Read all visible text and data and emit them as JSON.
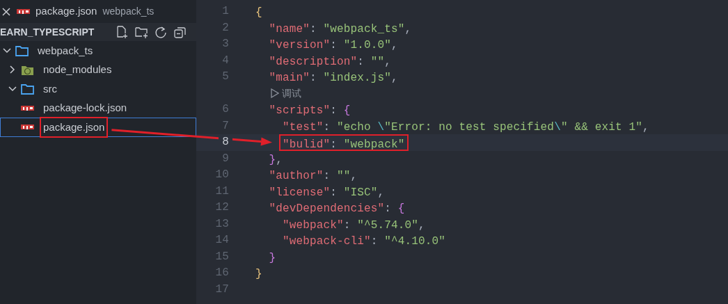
{
  "tab": {
    "file": "package.json",
    "folder": "webpack_ts"
  },
  "explorer": {
    "title": "EARN_TYPESCRIPT",
    "tree": [
      {
        "label": "webpack_ts",
        "kind": "folder",
        "expanded": true,
        "selected": false,
        "annotated": false,
        "children": [
          {
            "label": "node_modules",
            "kind": "node-folder",
            "expanded": false,
            "selected": false,
            "annotated": false
          },
          {
            "label": "src",
            "kind": "folder",
            "expanded": true,
            "selected": false,
            "annotated": false
          },
          {
            "label": "package-lock.json",
            "kind": "npm",
            "selected": false,
            "annotated": false
          },
          {
            "label": "package.json",
            "kind": "npm",
            "selected": true,
            "annotated": true
          }
        ]
      }
    ]
  },
  "editor": {
    "lines": [
      {
        "kind": "code",
        "number": "1",
        "current": false,
        "annotated": false,
        "tokens": [
          {
            "kind": "brace1",
            "text": "{"
          }
        ]
      },
      {
        "kind": "code",
        "number": "2",
        "current": false,
        "annotated": false,
        "tokens": [
          {
            "kind": "key",
            "text": "  \"name\""
          },
          {
            "kind": "punct",
            "text": ": "
          },
          {
            "kind": "string",
            "text": "\"webpack_ts\""
          },
          {
            "kind": "punct",
            "text": ","
          }
        ]
      },
      {
        "kind": "code",
        "number": "3",
        "current": false,
        "annotated": false,
        "tokens": [
          {
            "kind": "key",
            "text": "  \"version\""
          },
          {
            "kind": "punct",
            "text": ": "
          },
          {
            "kind": "string",
            "text": "\"1.0.0\""
          },
          {
            "kind": "punct",
            "text": ","
          }
        ]
      },
      {
        "kind": "code",
        "number": "4",
        "current": false,
        "annotated": false,
        "tokens": [
          {
            "kind": "key",
            "text": "  \"description\""
          },
          {
            "kind": "punct",
            "text": ": "
          },
          {
            "kind": "string",
            "text": "\"\""
          },
          {
            "kind": "punct",
            "text": ","
          }
        ]
      },
      {
        "kind": "code",
        "number": "5",
        "current": false,
        "annotated": false,
        "tokens": [
          {
            "kind": "key",
            "text": "  \"main\""
          },
          {
            "kind": "punct",
            "text": ": "
          },
          {
            "kind": "string",
            "text": "\"index.js\""
          },
          {
            "kind": "punct",
            "text": ","
          }
        ]
      },
      {
        "kind": "codelens",
        "text": "调试"
      },
      {
        "kind": "code",
        "number": "6",
        "current": false,
        "annotated": false,
        "tokens": [
          {
            "kind": "key",
            "text": "  \"scripts\""
          },
          {
            "kind": "punct",
            "text": ": "
          },
          {
            "kind": "brace2",
            "text": "{"
          }
        ]
      },
      {
        "kind": "code",
        "number": "7",
        "current": false,
        "annotated": false,
        "tokens": [
          {
            "kind": "key",
            "text": "    \"test\""
          },
          {
            "kind": "punct",
            "text": ": "
          },
          {
            "kind": "string",
            "text": "\"echo "
          },
          {
            "kind": "escape",
            "text": "\\"
          },
          {
            "kind": "string",
            "text": "\"Error: no test specified"
          },
          {
            "kind": "escape",
            "text": "\\"
          },
          {
            "kind": "string",
            "text": "\" && exit 1\""
          },
          {
            "kind": "punct",
            "text": ","
          }
        ]
      },
      {
        "kind": "code",
        "number": "8",
        "current": true,
        "annotated": true,
        "tokens": [
          {
            "kind": "key",
            "text": "    \"bulid\""
          },
          {
            "kind": "punct",
            "text": ": "
          },
          {
            "kind": "string",
            "text": "\"webpack\""
          }
        ]
      },
      {
        "kind": "code",
        "number": "9",
        "current": false,
        "annotated": false,
        "tokens": [
          {
            "kind": "brace2",
            "text": "  }"
          },
          {
            "kind": "punct",
            "text": ","
          }
        ]
      },
      {
        "kind": "code",
        "number": "10",
        "current": false,
        "annotated": false,
        "tokens": [
          {
            "kind": "key",
            "text": "  \"author\""
          },
          {
            "kind": "punct",
            "text": ": "
          },
          {
            "kind": "string",
            "text": "\"\""
          },
          {
            "kind": "punct",
            "text": ","
          }
        ]
      },
      {
        "kind": "code",
        "number": "11",
        "current": false,
        "annotated": false,
        "tokens": [
          {
            "kind": "key",
            "text": "  \"license\""
          },
          {
            "kind": "punct",
            "text": ": "
          },
          {
            "kind": "string",
            "text": "\"ISC\""
          },
          {
            "kind": "punct",
            "text": ","
          }
        ]
      },
      {
        "kind": "code",
        "number": "12",
        "current": false,
        "annotated": false,
        "tokens": [
          {
            "kind": "key",
            "text": "  \"devDependencies\""
          },
          {
            "kind": "punct",
            "text": ": "
          },
          {
            "kind": "brace2",
            "text": "{"
          }
        ]
      },
      {
        "kind": "code",
        "number": "13",
        "current": false,
        "annotated": false,
        "tokens": [
          {
            "kind": "key",
            "text": "    \"webpack\""
          },
          {
            "kind": "punct",
            "text": ": "
          },
          {
            "kind": "string",
            "text": "\"^5.74.0\""
          },
          {
            "kind": "punct",
            "text": ","
          }
        ]
      },
      {
        "kind": "code",
        "number": "14",
        "current": false,
        "annotated": false,
        "tokens": [
          {
            "kind": "key",
            "text": "    \"webpack-cli\""
          },
          {
            "kind": "punct",
            "text": ": "
          },
          {
            "kind": "string",
            "text": "\"^4.10.0\""
          }
        ]
      },
      {
        "kind": "code",
        "number": "15",
        "current": false,
        "annotated": false,
        "tokens": [
          {
            "kind": "brace2",
            "text": "  }"
          }
        ]
      },
      {
        "kind": "code",
        "number": "16",
        "current": false,
        "annotated": false,
        "tokens": [
          {
            "kind": "brace1",
            "text": "}"
          }
        ]
      },
      {
        "kind": "code",
        "number": "17",
        "current": false,
        "annotated": false
      }
    ]
  }
}
